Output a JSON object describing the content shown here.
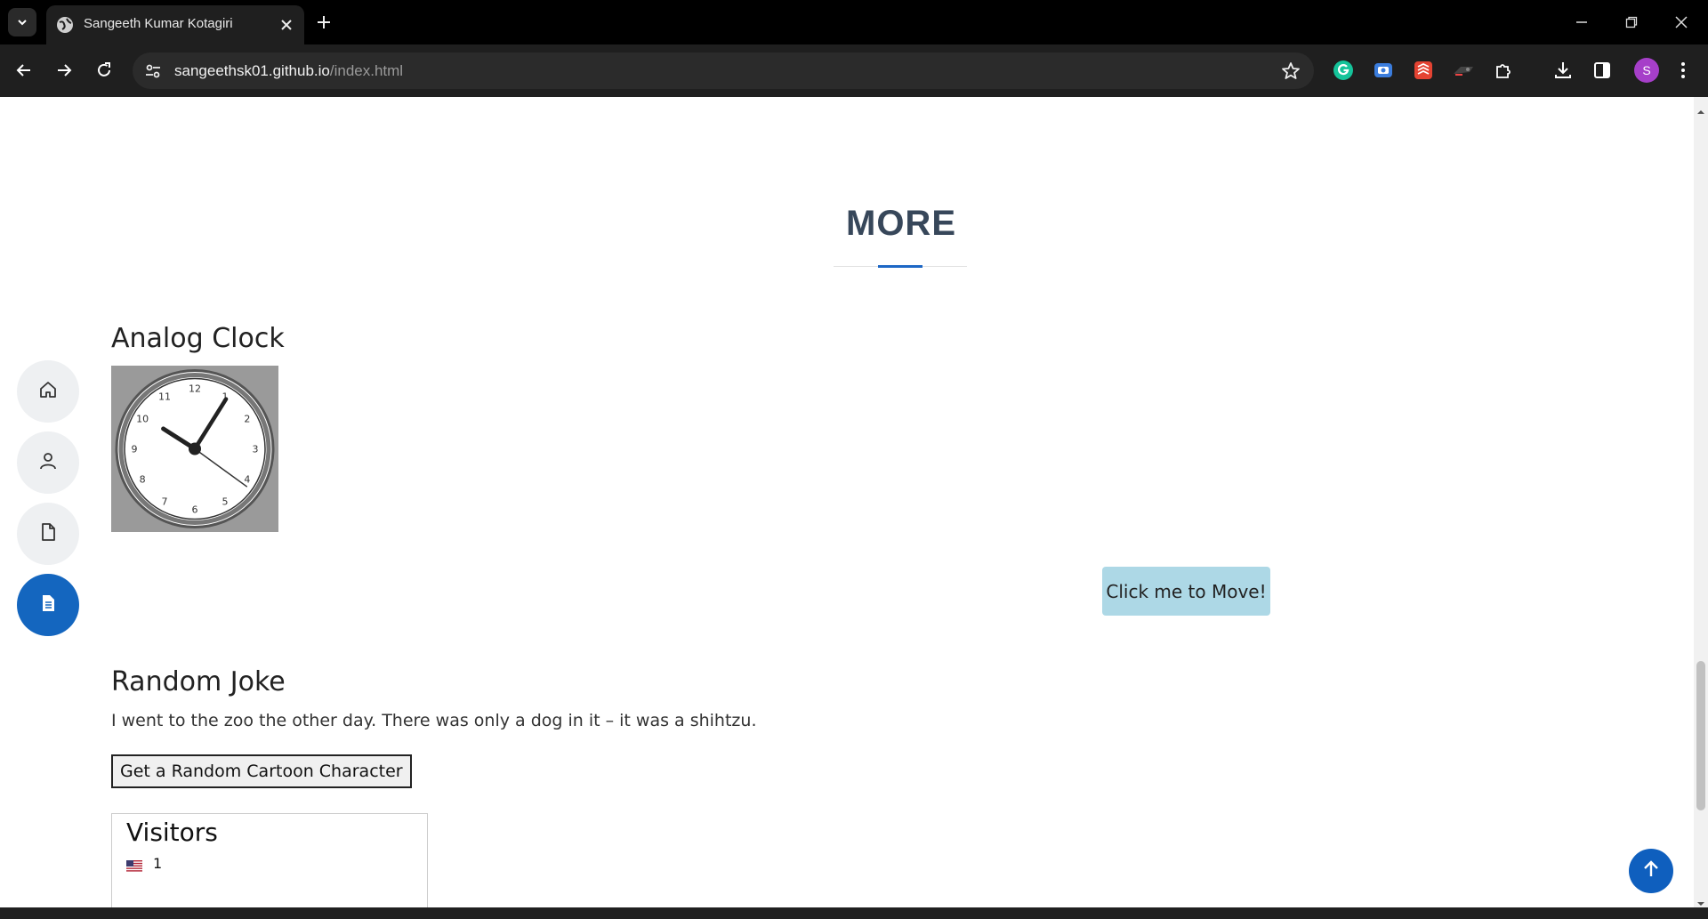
{
  "browser": {
    "tab_title": "Sangeeth Kumar Kotagiri",
    "url_host": "sangeethsk01.github.io",
    "url_path": "/index.html",
    "profile_initial": "S",
    "icons": {
      "tab_search": "chevron-down-icon",
      "favicon": "globe-icon",
      "close_tab": "close-icon",
      "new_tab": "plus-icon",
      "back": "arrow-left-icon",
      "forward": "arrow-right-icon",
      "reload": "reload-icon",
      "site_info": "tune-icon",
      "bookmark": "star-icon",
      "downloads": "download-icon",
      "side_panel": "side-panel-icon",
      "menu": "kebab-menu-icon"
    },
    "extensions": [
      "grammarly-icon",
      "screenshot-ext-icon",
      "todoist-icon",
      "extension-misc-icon",
      "puzzle-icon"
    ]
  },
  "page": {
    "section_title": "MORE",
    "clock": {
      "heading": "Analog Clock",
      "numbers": [
        "12",
        "1",
        "2",
        "3",
        "4",
        "5",
        "6",
        "7",
        "8",
        "9",
        "10",
        "11"
      ],
      "time": {
        "hour": 10,
        "minute": 5,
        "second": 21
      }
    },
    "move_button": "Click me to Move!",
    "joke": {
      "heading": "Random Joke",
      "text": "I went to the zoo the other day. There was only a dog in it – it was a shihtzu."
    },
    "cartoon_button": "Get a Random Cartoon Character",
    "visitors": {
      "title": "Visitors",
      "count": "1",
      "flag": "us-flag-icon"
    },
    "side_nav": [
      {
        "icon": "home-icon",
        "active": false
      },
      {
        "icon": "user-icon",
        "active": false
      },
      {
        "icon": "file-icon",
        "active": false
      },
      {
        "icon": "document-icon",
        "active": true
      }
    ],
    "back_to_top_icon": "arrow-up-icon",
    "accent_color": "#1466bf"
  }
}
